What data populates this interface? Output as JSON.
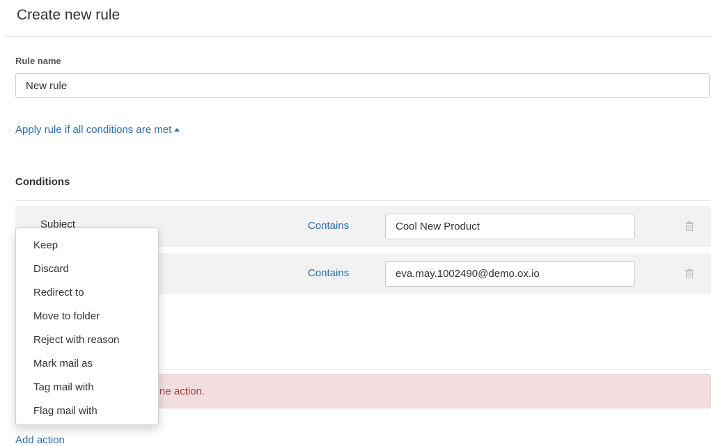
{
  "header": {
    "title": "Create new rule"
  },
  "rule": {
    "label": "Rule name",
    "value": "New rule"
  },
  "apply_link": {
    "label": "Apply rule if all conditions are met",
    "icon": "caret-up-icon"
  },
  "conditions": {
    "heading": "Conditions",
    "items": [
      {
        "field": "Subject",
        "operator": "Contains",
        "value": "Cool New Product"
      },
      {
        "field": "",
        "operator": "Contains",
        "value": "eva.may.1002490@demo.ox.io"
      }
    ]
  },
  "alert": {
    "text": "ne action."
  },
  "add_action": {
    "label": "Add action"
  },
  "action_menu": {
    "items": [
      "Keep",
      "Discard",
      "Redirect to",
      "Move to folder",
      "Reject with reason",
      "Mark mail as",
      "Tag mail with",
      "Flag mail with"
    ]
  },
  "colors": {
    "link": "#2a6fb0",
    "alert_bg": "#f2dede",
    "alert_text": "#a94442",
    "row_bg": "#f2f2f2"
  }
}
